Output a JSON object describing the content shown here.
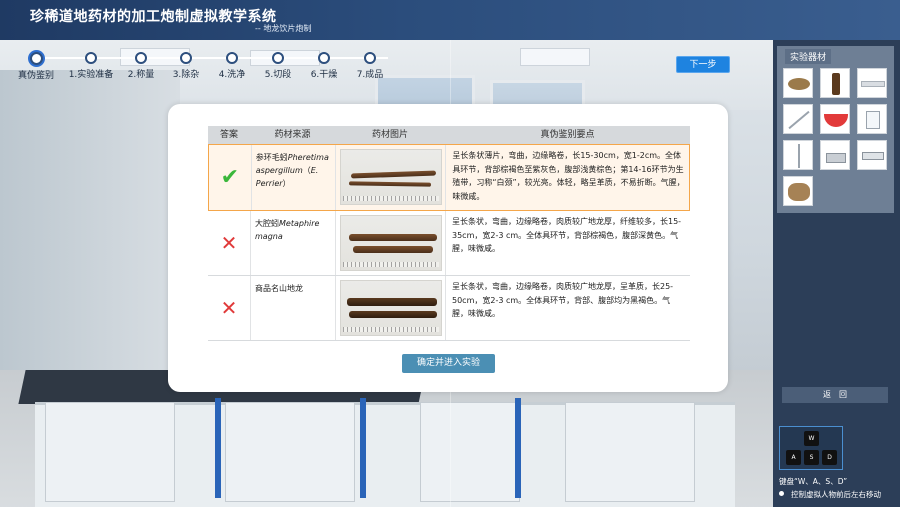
{
  "header": {
    "title": "珍稀道地药材的加工炮制虚拟教学系统",
    "subtitle": "-- 地龙饮片炮制"
  },
  "steps": [
    {
      "label": "真伪鉴别",
      "active": true
    },
    {
      "label": "1.实验准备"
    },
    {
      "label": "2.称量"
    },
    {
      "label": "3.除杂"
    },
    {
      "label": "4.洗净"
    },
    {
      "label": "5.切段"
    },
    {
      "label": "6.干燥"
    },
    {
      "label": "7.成品"
    }
  ],
  "next_button": "下一步",
  "table": {
    "headers": [
      "答案",
      "药材来源",
      "药材图片",
      "真伪鉴别要点"
    ],
    "rows": [
      {
        "answer": "correct",
        "answer_icon": "checkmark-icon",
        "source_cn": "参环毛蚓",
        "source_latin": "Pheretima aspergillum",
        "source_author": "E. Perrier",
        "source_open": "（",
        "source_close": "）",
        "description": "呈长条状薄片，弯曲，边缘略卷，长15-30cm，宽1-2cm。全体具环节，背部棕褐色至紫灰色，腹部浅黄棕色；第14-16环节为生殖带，习称“白颈”，较光亮。体轻，略呈革质，不易折断。气腥，味微咸。"
      },
      {
        "answer": "wrong",
        "answer_icon": "cross-icon",
        "source_cn": "大腔蚓",
        "source_latin": "Metaphire magna",
        "description": "呈长条状，弯曲，边缘略卷，肉质较广地龙厚，纤维较多，长15-35cm，宽2-3 cm。全体具环节，背部棕褐色，腹部深黄色。气腥，味微咸。"
      },
      {
        "answer": "wrong",
        "answer_icon": "cross-icon",
        "source_cn": "商品名山地龙",
        "description": "呈长条状，弯曲，边缘略卷，肉质较广地龙厚，呈革质，长25-50cm，宽2-3 cm。全体具环节，背部、腹部均为黑褐色。气腥，味微咸。"
      }
    ]
  },
  "confirm_button": "确定并进入实验",
  "right_panel": {
    "equipment_title": "实验器材",
    "items": [
      "herb-pile-icon",
      "bottle-icon",
      "tray-icon",
      "knife-icon",
      "basin-icon",
      "beaker-icon",
      "thermometer-icon",
      "scale-icon",
      "pan-icon",
      "herb-slices-icon"
    ],
    "back_button": "返　回",
    "keys": [
      "W",
      "A",
      "S",
      "D"
    ],
    "hint_line1": "键盘“W、A、S、D”",
    "hint_line2": "控制虚拟人物前后左右移动"
  },
  "colors": {
    "accent": "#1e83e0",
    "check": "#3bb73b",
    "cross": "#e03a3a",
    "selected_border": "#f4a64a"
  }
}
